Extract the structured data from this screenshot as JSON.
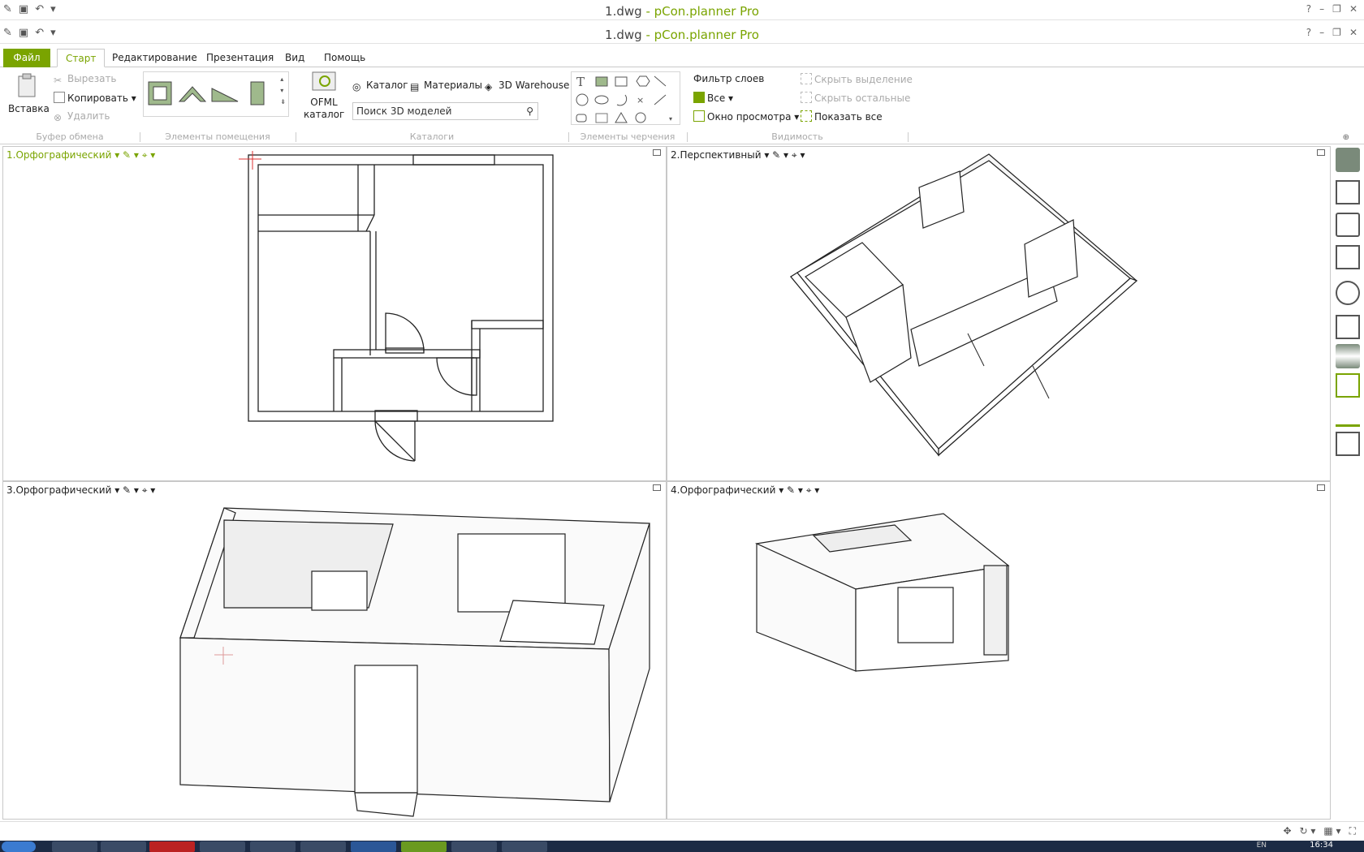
{
  "window": {
    "doc_name": "1.dwg",
    "title_sep": " - ",
    "app_name": "pCon.planner Pro",
    "controls": [
      "?",
      "–",
      "❐",
      "✕"
    ]
  },
  "tabs": {
    "file": "Файл",
    "items": [
      "Старт",
      "Редактирование",
      "Презентация",
      "Вид",
      "Помощь"
    ]
  },
  "clipboard": {
    "paste": "Вставка",
    "cut": "Вырезать",
    "copy": "Копировать",
    "delete": "Удалить",
    "label": "Буфер обмена"
  },
  "room": {
    "label": "Элементы помещения"
  },
  "catalogs": {
    "ofml": "OFML каталог",
    "catalog": "Каталог",
    "materials": "Материалы",
    "warehouse": "3D Warehouse",
    "search_placeholder": "Поиск 3D моделей",
    "label": "Каталоги"
  },
  "drawing": {
    "label": "Элементы черчения"
  },
  "visibility": {
    "layer_filter": "Фильтр слоев",
    "all": "Все",
    "viewport_window": "Окно просмотра",
    "hide_selection": "Скрыть выделение",
    "hide_others": "Скрыть остальные",
    "show_all": "Показать все",
    "label": "Видимость"
  },
  "viewports": [
    {
      "label": "1.Орфографический"
    },
    {
      "label": "2.Перспективный"
    },
    {
      "label": "3.Орфографический"
    },
    {
      "label": "4.Орфографический"
    }
  ],
  "sidebar_icons": [
    "tools-icon",
    "catalog-search-icon",
    "objects-icon",
    "list-icon",
    "web-search-icon",
    "box-icon",
    "layers-icon",
    "settings-icon",
    "pen-icon",
    "grid-tool-icon"
  ],
  "taskbar": {
    "clock": "16:34",
    "lang": "EN"
  },
  "colors": {
    "accent": "#7aa400"
  }
}
